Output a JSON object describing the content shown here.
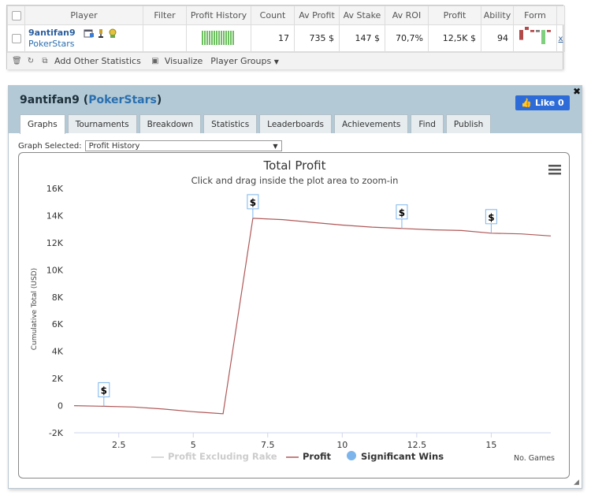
{
  "table": {
    "headers": [
      "Player",
      "Filter",
      "Profit History",
      "Count",
      "Av Profit",
      "Av Stake",
      "Av ROI",
      "Profit",
      "Ability",
      "Form"
    ],
    "row": {
      "player_name": "9antifan9",
      "player_site": "PokerStars",
      "count": "17",
      "av_profit": "735 $",
      "av_stake": "147 $",
      "av_roi": "70,7%",
      "profit": "12,5K $",
      "ability": "94",
      "remove_link": "x"
    },
    "form_bars": [
      {
        "value": 0.7,
        "color": "#b34a4a",
        "direction": "down"
      },
      {
        "value": 0.3,
        "color": "#b34a4a",
        "direction": "up"
      },
      {
        "value": 0.15,
        "color": "#b34a4a",
        "direction": "down"
      },
      {
        "value": 0.15,
        "color": "#7a7a7a",
        "direction": "down"
      },
      {
        "value": 1.0,
        "color": "#7fcf7f",
        "direction": "down"
      },
      {
        "value": 0.15,
        "color": "#b34a4a",
        "direction": "down"
      }
    ]
  },
  "toolbar": {
    "add_stats": "Add Other Statistics",
    "visualize": "Visualize",
    "player_groups": "Player Groups"
  },
  "panel": {
    "player_name": "9antifan9",
    "site": "PokerStars",
    "like_label": "Like 0",
    "tabs": [
      "Graphs",
      "Tournaments",
      "Breakdown",
      "Statistics",
      "Leaderboards",
      "Achievements",
      "Find",
      "Publish"
    ],
    "active_tab": "Graphs",
    "graph_selected_label": "Graph Selected:",
    "graph_selected_value": "Profit History"
  },
  "colors": {
    "header_bg": "#b3cad6",
    "profit_line": "#b05858",
    "significant_marker": "#7cb5ec",
    "like_button": "#2d6bd8",
    "profit_history_bars": "#6cbf5e"
  },
  "chart_data": {
    "type": "line",
    "title": "Total Profit",
    "subtitle": "Click and drag inside the plot area to zoom-in",
    "ylabel": "Cumulative Total (USD)",
    "xlabel": "No. Games",
    "xlim": [
      1,
      17
    ],
    "ylim": [
      -2000,
      16000
    ],
    "xticks": [
      2.5,
      5,
      7.5,
      10,
      12.5,
      15
    ],
    "xtick_labels": [
      "2.5",
      "5",
      "7.5",
      "10",
      "12.5",
      "15"
    ],
    "yticks": [
      -2000,
      0,
      2000,
      4000,
      6000,
      8000,
      10000,
      12000,
      14000,
      16000
    ],
    "ytick_labels": [
      "-2K",
      "0",
      "2K",
      "4K",
      "6K",
      "8K",
      "10K",
      "12K",
      "14K",
      "16K"
    ],
    "series": [
      {
        "name": "Profit",
        "x": [
          1,
          2,
          3,
          4,
          5,
          6,
          7,
          8,
          9,
          10,
          11,
          12,
          13,
          14,
          15,
          16,
          17
        ],
        "values": [
          0,
          -50,
          -100,
          -250,
          -450,
          -600,
          13800,
          13700,
          13500,
          13300,
          13150,
          13050,
          12950,
          12900,
          12700,
          12650,
          12500
        ]
      }
    ],
    "significant_wins": [
      {
        "x": 2,
        "y": -50,
        "label": "$"
      },
      {
        "x": 7,
        "y": 13800,
        "label": "$"
      },
      {
        "x": 12,
        "y": 13050,
        "label": "$"
      },
      {
        "x": 15,
        "y": 12700,
        "label": "$"
      }
    ],
    "legend": {
      "placement": "bottom-center",
      "items": [
        "Profit Excluding Rake",
        "Profit",
        "Significant Wins"
      ]
    },
    "grid": false
  }
}
